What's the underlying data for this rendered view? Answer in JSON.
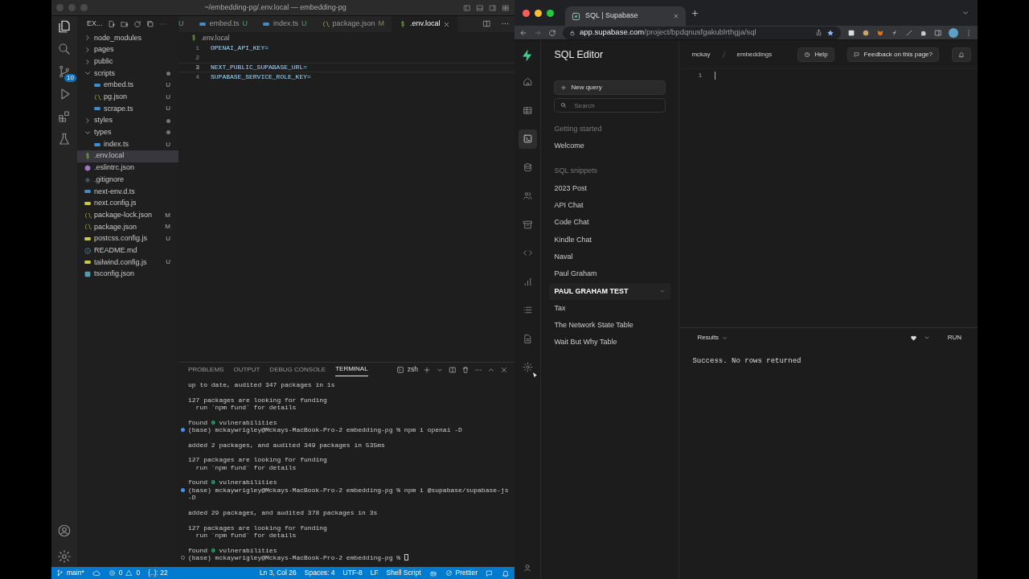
{
  "vscode": {
    "title": "~/embedding-pg/.env.local — embedding-pg",
    "activity": [
      {
        "kind": "files",
        "selected": true
      },
      {
        "kind": "search",
        "selected": false
      },
      {
        "kind": "scm",
        "selected": false,
        "badge": "10"
      },
      {
        "kind": "debug",
        "selected": false
      },
      {
        "kind": "extensions",
        "selected": false
      },
      {
        "kind": "testing",
        "selected": false
      }
    ],
    "activity_bottom": [
      {
        "kind": "account"
      },
      {
        "kind": "settings"
      }
    ],
    "explorer_title": "EX...",
    "tabs": [
      {
        "badge": "U",
        "selected": false
      },
      {
        "kind": "ts",
        "label": "embed.ts",
        "badge": "U",
        "selected": false
      },
      {
        "kind": "ts",
        "label": "index.ts",
        "badge": "U",
        "selected": false
      },
      {
        "kind": "json",
        "label": "package.json",
        "badge": "M",
        "selected": false
      },
      {
        "kind": "env",
        "label": ".env.local",
        "selected": true
      }
    ],
    "tree": [
      {
        "kind": "folder",
        "label": "node_modules",
        "expanded": false,
        "selected": false
      },
      {
        "kind": "folder",
        "label": "pages",
        "expanded": false,
        "selected": false
      },
      {
        "kind": "folder",
        "label": "public",
        "expanded": false,
        "selected": false
      },
      {
        "kind": "folder",
        "label": "scripts",
        "expanded": true,
        "dot": true,
        "selected": false,
        "children": [
          {
            "kind": "ts",
            "label": "embed.ts",
            "badge": "U",
            "selected": false
          },
          {
            "kind": "json",
            "label": "pg.json",
            "badge": "U",
            "selected": false
          },
          {
            "kind": "ts",
            "label": "scrape.ts",
            "badge": "U",
            "selected": false
          }
        ]
      },
      {
        "kind": "folder",
        "label": "styles",
        "expanded": false,
        "dot": true,
        "selected": false
      },
      {
        "kind": "folder",
        "label": "types",
        "expanded": true,
        "dot": true,
        "selected": false,
        "children": [
          {
            "kind": "ts",
            "label": "index.ts",
            "badge": "U",
            "selected": false
          }
        ]
      },
      {
        "kind": "env",
        "label": ".env.local",
        "selected": true
      },
      {
        "kind": "eslint",
        "label": ".eslintrc.json",
        "selected": false
      },
      {
        "kind": "git",
        "label": ".gitignore",
        "selected": false
      },
      {
        "kind": "ts",
        "label": "next-env.d.ts",
        "selected": false
      },
      {
        "kind": "js",
        "label": "next.config.js",
        "selected": false
      },
      {
        "kind": "json",
        "label": "package-lock.json",
        "badge": "M",
        "selected": false
      },
      {
        "kind": "json",
        "label": "package.json",
        "badge": "M",
        "selected": false
      },
      {
        "kind": "js",
        "label": "postcss.config.js",
        "badge": "U",
        "selected": false
      },
      {
        "kind": "info",
        "label": "README.md",
        "selected": false
      },
      {
        "kind": "js",
        "label": "tailwind.config.js",
        "badge": "U",
        "selected": false
      },
      {
        "kind": "tsconfig",
        "label": "tsconfig.json",
        "selected": false
      }
    ],
    "breadcrumb": ".env.local",
    "code": [
      {
        "number": "1",
        "text": "OPENAI_API_KEY=",
        "current": false
      },
      {
        "number": "2",
        "current": false
      },
      {
        "number": "3",
        "text": "NEXT_PUBLIC_SUPABASE_URL=",
        "current": true
      },
      {
        "number": "4",
        "text": "SUPABASE_SERVICE_ROLE_KEY=",
        "current": false
      }
    ],
    "panel_tabs": [
      {
        "label": "PROBLEMS",
        "selected": false
      },
      {
        "label": "OUTPUT",
        "selected": false
      },
      {
        "label": "DEBUG CONSOLE",
        "selected": false
      },
      {
        "label": "TERMINAL",
        "selected": true
      }
    ],
    "shell": "zsh",
    "terminal": [
      [
        {
          "text": "up to date, audited 347 packages in 1s"
        }
      ],
      [
        {
          "text": "127 packages are looking for funding"
        },
        {
          "text": "  run `npm fund` for details"
        }
      ],
      [
        {
          "text": "found **0** vulnerabilities"
        },
        {
          "text": "(base) mckaywrigley@Mckays-MacBook-Pro-2 embedding-pg % npm i openai -D",
          "kind": "prompt",
          "done": true
        }
      ],
      [
        {
          "text": "added 2 packages, and audited 349 packages in 535ms"
        }
      ],
      [
        {
          "text": "127 packages are looking for funding"
        },
        {
          "text": "  run `npm fund` for details"
        }
      ],
      [
        {
          "text": "found **0** vulnerabilities"
        },
        {
          "text": "(base) mckaywrigley@Mckays-MacBook-Pro-2 embedding-pg % npm i @supabase/supabase-js",
          "kind": "prompt",
          "done": true
        },
        {
          "text": "-D"
        }
      ],
      [
        {
          "text": "added 29 packages, and audited 378 packages in 3s"
        }
      ],
      [
        {
          "text": "127 packages are looking for funding"
        },
        {
          "text": "  run `npm fund` for details"
        }
      ],
      [
        {
          "text": "found **0** vulnerabilities"
        },
        {
          "text": "(base) mckaywrigley@Mckays-MacBook-Pro-2 embedding-pg % ",
          "kind": "prompt",
          "done": false,
          "cursor": true
        }
      ]
    ],
    "status_left": [
      {
        "kind": "branch",
        "text": "main*"
      },
      {
        "kind": "sync"
      },
      {
        "kind": "problems",
        "errors": "0",
        "warnings": "0"
      },
      {
        "kind": "plain",
        "text": "{..}: 22"
      }
    ],
    "status_right": [
      {
        "kind": "plain",
        "text": "Ln 3, Col 26"
      },
      {
        "kind": "plain",
        "text": "Spaces: 4"
      },
      {
        "kind": "plain",
        "text": "UTF-8"
      },
      {
        "kind": "plain",
        "text": "LF"
      },
      {
        "kind": "plain",
        "text": "Shell Script"
      },
      {
        "kind": "copilot"
      },
      {
        "kind": "prettier",
        "text": "Prettier"
      },
      {
        "kind": "feedback"
      },
      {
        "kind": "bell"
      }
    ]
  },
  "browser": {
    "tab_title": "SQL | Supabase",
    "url_host": "app.supabase.com",
    "url_path": "/project/bpdqnusfgakublrthgja/sql"
  },
  "supabase": {
    "title": "SQL Editor",
    "rail": [
      {
        "kind": "home",
        "selected": false
      },
      {
        "kind": "table",
        "selected": false
      },
      {
        "kind": "sql",
        "selected": true
      },
      {
        "kind": "database",
        "selected": false
      },
      {
        "kind": "users",
        "selected": false
      },
      {
        "kind": "storage",
        "selected": false
      },
      {
        "kind": "code",
        "selected": false
      },
      {
        "kind": "chart",
        "selected": false
      },
      {
        "kind": "list",
        "selected": false
      },
      {
        "kind": "doc",
        "selected": false
      },
      {
        "kind": "settings",
        "selected": false
      }
    ],
    "breadcrumb": [
      "mckay",
      "embeddings"
    ],
    "help": "Help",
    "feedback": "Feedback on this page?",
    "new_query": "New query",
    "search": {
      "placeholder": "Search"
    },
    "sections": [
      {
        "heading": "Getting started",
        "items": [
          {
            "label": "Welcome",
            "selected": false
          }
        ]
      },
      {
        "heading": "SQL snippets",
        "items": [
          {
            "label": "2023 Post",
            "selected": false
          },
          {
            "label": "API Chat",
            "selected": false
          },
          {
            "label": "Code Chat",
            "selected": false
          },
          {
            "label": "Kindle Chat",
            "selected": false
          },
          {
            "label": "Naval",
            "selected": false
          },
          {
            "label": "Paul Graham",
            "selected": false
          },
          {
            "label": "PAUL GRAHAM TEST",
            "selected": true
          },
          {
            "label": "Tax",
            "selected": false
          },
          {
            "label": "The Network State Table",
            "selected": false
          },
          {
            "label": "Wait But Why Table",
            "selected": false
          }
        ]
      }
    ],
    "editor_lines": [
      "1"
    ],
    "results_label": "Results",
    "run": "RUN",
    "result": "Success. No rows returned"
  }
}
